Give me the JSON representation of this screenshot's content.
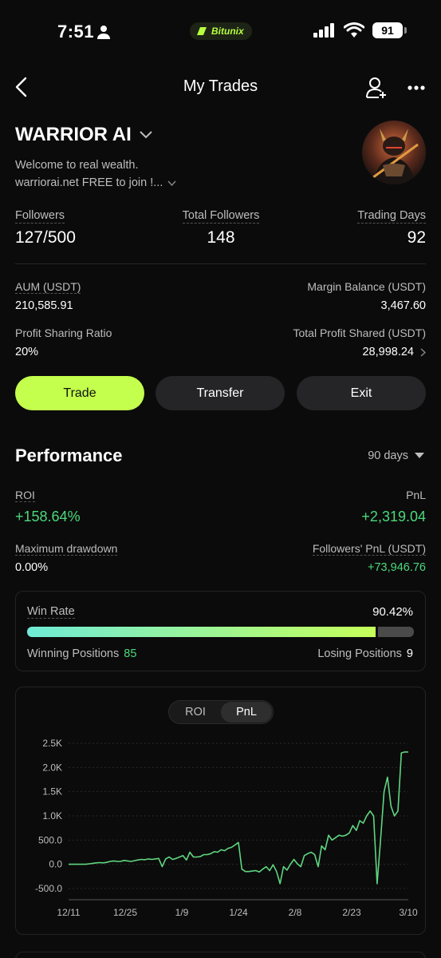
{
  "status": {
    "time": "7:51",
    "app_badge": "Bitunix",
    "battery": "91"
  },
  "nav": {
    "title": "My Trades"
  },
  "trader": {
    "name": "WARRIOR AI",
    "bio_line1": "Welcome to real wealth.",
    "bio_line2": "warriorai.net FREE to join !..."
  },
  "stats": {
    "followers_label": "Followers",
    "followers_value": "127/500",
    "total_followers_label": "Total Followers",
    "total_followers_value": "148",
    "trading_days_label": "Trading Days",
    "trading_days_value": "92"
  },
  "account": {
    "aum_label": "AUM (USDT)",
    "aum_value": "210,585.91",
    "margin_label": "Margin Balance (USDT)",
    "margin_value": "3,467.60",
    "psr_label": "Profit Sharing Ratio",
    "psr_value": "20%",
    "tps_label": "Total Profit Shared (USDT)",
    "tps_value": "28,998.24"
  },
  "actions": {
    "trade": "Trade",
    "transfer": "Transfer",
    "exit": "Exit"
  },
  "performance": {
    "title": "Performance",
    "period": "90 days",
    "roi_label": "ROI",
    "roi_value": "+158.64%",
    "pnl_label": "PnL",
    "pnl_value": "+2,319.04",
    "mdd_label": "Maximum drawdown",
    "mdd_value": "0.00%",
    "fpnl_label": "Followers' PnL (USDT)",
    "fpnl_value": "+73,946.76"
  },
  "winrate": {
    "label": "Win Rate",
    "value": "90.42%",
    "fraction": 0.9042,
    "winning_label": "Winning Positions",
    "winning_value": "85",
    "losing_label": "Losing Positions",
    "losing_value": "9"
  },
  "colors": {
    "accent": "#c3ff4c",
    "positive": "#4cd97b",
    "line": "#5fd680"
  },
  "chart_toggle": {
    "roi": "ROI",
    "pnl": "PnL",
    "active": "PnL"
  },
  "chart_data": {
    "type": "line",
    "ylim": [
      -600,
      2500
    ],
    "yticks": [
      2500,
      2000,
      1500,
      1000,
      500,
      0,
      -500
    ],
    "ytick_labels": [
      "2.5K",
      "2.0K",
      "1.5K",
      "1.0K",
      "500.0",
      "0.0",
      "-500.0"
    ],
    "xtick_labels": [
      "12/11",
      "12/25",
      "1/9",
      "1/24",
      "2/8",
      "2/23",
      "3/10"
    ],
    "grid": true,
    "series": [
      {
        "values": [
          0,
          0,
          0,
          0,
          0,
          0,
          10,
          20,
          30,
          35,
          30,
          40,
          60,
          70,
          60,
          60,
          80,
          70,
          60,
          75,
          90,
          100,
          95,
          110,
          100,
          110,
          120,
          -50,
          110,
          150,
          100,
          120,
          150,
          180,
          90,
          250,
          150,
          150,
          160,
          200,
          200,
          220,
          260,
          250,
          300,
          280,
          330,
          350,
          400,
          450,
          -100,
          -150,
          -150,
          -140,
          -130,
          -160,
          -100,
          -50,
          -130,
          -10,
          -150,
          -400,
          -50,
          -120,
          0,
          100,
          10,
          -50,
          180,
          220,
          250,
          200,
          -50,
          380,
          300,
          600,
          500,
          550,
          600,
          580,
          600,
          650,
          800,
          700,
          900,
          850,
          1000,
          1100,
          1000,
          -400,
          500,
          1500,
          1800,
          1200,
          1000,
          1100,
          2300,
          2320,
          2319
        ]
      }
    ]
  }
}
